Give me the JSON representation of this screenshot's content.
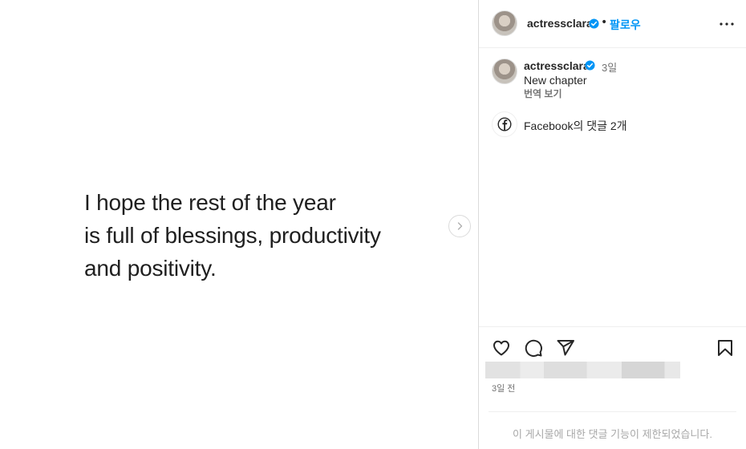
{
  "media": {
    "quote_lines": [
      "I hope the rest of the year",
      "is full of blessings, productivity",
      "and positivity."
    ],
    "next_icon": "chevron-right-icon"
  },
  "header": {
    "username": "actressclara",
    "verified_icon": "verified-badge-icon",
    "separator": "•",
    "follow_label": "팔로우",
    "more_icon": "more-horizontal-icon"
  },
  "caption": {
    "username": "actressclara",
    "time": "3일",
    "text": "New chapter",
    "translate_label": "번역 보기"
  },
  "facebook": {
    "icon": "facebook-icon",
    "label": "Facebook의 댓글 2개"
  },
  "actions": {
    "like_icon": "heart-icon",
    "comment_icon": "comment-icon",
    "share_icon": "send-icon",
    "save_icon": "bookmark-icon"
  },
  "footer": {
    "date": "3일 전",
    "comments_disabled": "이 게시물에 대한 댓글 기능이 제한되었습니다."
  },
  "colors": {
    "accent": "#0095f6",
    "verified": "#0095f6",
    "border": "#dbdbdb",
    "muted": "#737373"
  }
}
